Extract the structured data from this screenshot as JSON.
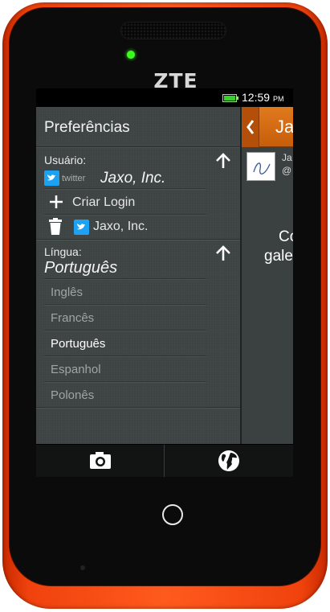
{
  "device": {
    "brand": "ZTE"
  },
  "status": {
    "time": "12:59",
    "ampm": "PM",
    "battery_level": 1.0
  },
  "drawer": {
    "title": "Preferências",
    "user_section": {
      "label": "Usuário:",
      "service_badge": "twitter",
      "current_account": "Jaxo, Inc.",
      "create_login_label": "Criar Login",
      "accounts": [
        {
          "name": "Jaxo, Inc."
        }
      ]
    },
    "language_section": {
      "label": "Língua:",
      "current": "Português",
      "options": [
        "Inglês",
        "Francês",
        "Português",
        "Espanhol",
        "Polonês"
      ],
      "selected_index": 2
    }
  },
  "content": {
    "title": "Ja",
    "meta_line1": "Ja",
    "meta_line2": "@",
    "empty_line1": "Co",
    "empty_line2": "gale"
  },
  "bottom_bar": {
    "left_icon": "camera-icon",
    "right_icon": "globe-icon"
  },
  "colors": {
    "case": "#ff5a1e",
    "drawer_bg": "#3e4444",
    "header_accent": "#e07a1e",
    "twitter_blue": "#1da1f2",
    "led_green": "#3cff20"
  }
}
